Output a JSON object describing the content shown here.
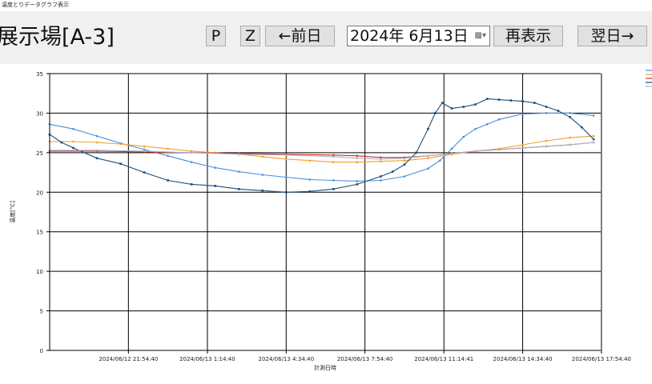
{
  "window": {
    "title": "温度とりデータグラフ表示"
  },
  "header": {
    "title": "展示場[A-3]",
    "p_label": "P",
    "z_label": "Z",
    "prev_label": "←前日",
    "date_value": "2024年  6月13日",
    "refresh_label": "再表示",
    "next_label": "翌日→"
  },
  "icons": {
    "calendar": "calendar-dropdown-icon"
  },
  "chart_data": {
    "type": "line",
    "xlabel": "計測日時",
    "ylabel": "温度[°C]",
    "ylim": [
      0,
      35
    ],
    "yticks": [
      0,
      5,
      10,
      15,
      20,
      25,
      30,
      35
    ],
    "x_range": [
      0,
      23.3
    ],
    "xtick_labels": [
      "2024/06/12 21:54:40",
      "2024/06/13 1:14:40",
      "2024/06/13 4:34:40",
      "2024/06/13 7:54:40",
      "2024/06/13 11:14:41",
      "2024/06/13 14:34:40",
      "2024/06/13 17:54:40"
    ],
    "xtick_positions": [
      3.33,
      6.67,
      10.0,
      13.33,
      16.67,
      20.0,
      23.33
    ],
    "grid": true,
    "legend_position": "top-right (outside plot, labels cropped)",
    "series": [
      {
        "color": "#4a90d9",
        "marker": "point",
        "x": [
          0,
          1,
          2,
          3,
          4,
          5,
          6,
          7,
          8,
          9,
          10,
          11,
          12,
          13,
          14,
          15,
          16,
          16.5,
          17,
          17.5,
          18,
          18.5,
          19,
          20,
          21,
          22,
          23
        ],
        "y": [
          28.6,
          28.0,
          27.1,
          26.2,
          25.4,
          24.6,
          23.8,
          23.1,
          22.6,
          22.2,
          21.9,
          21.6,
          21.5,
          21.4,
          21.5,
          22.0,
          23.0,
          24.0,
          25.5,
          27.0,
          28.0,
          28.6,
          29.2,
          29.9,
          30.0,
          30.0,
          29.7
        ]
      },
      {
        "color": "#f0a030",
        "marker": "point",
        "x": [
          0,
          1,
          2,
          3,
          4,
          5,
          6,
          7,
          8,
          9,
          10,
          11,
          12,
          13,
          14,
          15,
          16,
          17,
          18,
          19,
          20,
          21,
          22,
          23
        ],
        "y": [
          26.4,
          26.4,
          26.3,
          26.1,
          25.8,
          25.5,
          25.2,
          25.0,
          24.8,
          24.5,
          24.2,
          24.0,
          23.8,
          23.8,
          23.9,
          24.0,
          24.3,
          24.8,
          25.2,
          25.5,
          26.0,
          26.5,
          26.9,
          27.1
        ]
      },
      {
        "color": "#c83020",
        "marker": "point",
        "x": [
          0,
          2,
          4,
          6,
          8,
          10,
          12,
          13,
          14,
          15,
          16,
          17,
          18,
          19,
          20,
          21,
          22,
          23
        ],
        "y": [
          25.2,
          25.2,
          25.1,
          25.0,
          24.9,
          24.8,
          24.7,
          24.6,
          24.4,
          24.4,
          24.6,
          24.9,
          25.2,
          25.4,
          25.6,
          25.8,
          26.0,
          26.3
        ]
      },
      {
        "color": "#1b4f7a",
        "marker": "square",
        "x": [
          0,
          0.5,
          1,
          2,
          3,
          4,
          5,
          6,
          7,
          8,
          9,
          10,
          11,
          12,
          13,
          14,
          14.5,
          15,
          15.5,
          16,
          16.3,
          16.6,
          17,
          17.5,
          18,
          18.5,
          19,
          19.5,
          20,
          20.5,
          21,
          21.5,
          22,
          22.5,
          23
        ],
        "y": [
          27.3,
          26.3,
          25.6,
          24.3,
          23.6,
          22.5,
          21.5,
          21.0,
          20.8,
          20.4,
          20.2,
          20.0,
          20.1,
          20.4,
          21.0,
          22.0,
          22.6,
          23.5,
          25.0,
          28.0,
          30.0,
          31.3,
          30.6,
          30.8,
          31.1,
          31.8,
          31.7,
          31.6,
          31.5,
          31.3,
          30.8,
          30.3,
          29.5,
          28.2,
          26.7
        ]
      },
      {
        "color": "#b0b0c8",
        "marker": "point",
        "x": [
          0,
          2,
          4,
          6,
          8,
          10,
          12,
          13,
          14,
          15,
          16,
          17,
          18,
          19,
          20,
          21,
          22,
          23
        ],
        "y": [
          25.3,
          25.3,
          25.2,
          25.0,
          24.8,
          24.7,
          24.5,
          24.3,
          24.2,
          24.3,
          24.6,
          24.9,
          25.2,
          25.4,
          25.6,
          25.8,
          26.0,
          26.3
        ]
      }
    ]
  }
}
